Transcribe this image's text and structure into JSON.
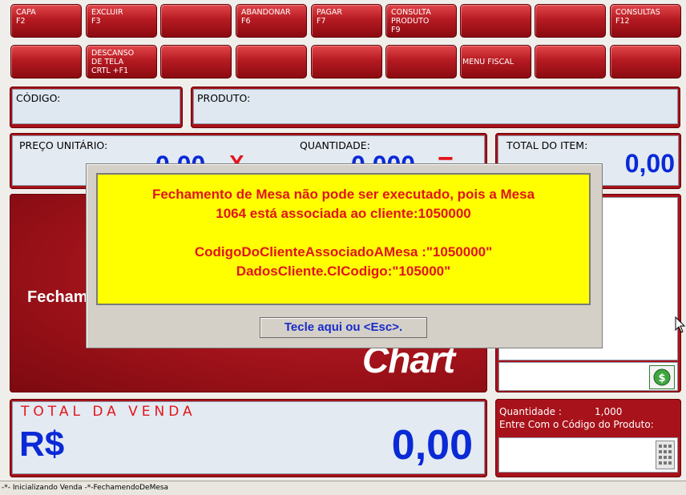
{
  "buttons_row1": [
    {
      "label": "CAPA\nF2"
    },
    {
      "label": "EXCLUIR\nF3"
    },
    {
      "label": ""
    },
    {
      "label": "ABANDONAR\nF6"
    },
    {
      "label": "PAGAR\nF7"
    },
    {
      "label": "CONSULTA\nPRODUTO\nF9"
    },
    {
      "label": ""
    },
    {
      "label": ""
    },
    {
      "label": "CONSULTAS\nF12"
    }
  ],
  "buttons_row2": [
    {
      "label": ""
    },
    {
      "label": "DESCANSO\nDE TELA\nCRTL +F1"
    },
    {
      "label": ""
    },
    {
      "label": ""
    },
    {
      "label": ""
    },
    {
      "label": ""
    },
    {
      "label": "MENU FISCAL"
    },
    {
      "label": ""
    },
    {
      "label": ""
    }
  ],
  "codigo": {
    "label": "CÓDIGO:",
    "value": ""
  },
  "produto": {
    "label": "PRODUTO:",
    "value": ""
  },
  "preco": {
    "label": "PREÇO UNITÁRIO:",
    "value": "0,00"
  },
  "multiply_sign": "X",
  "quantidade": {
    "label": "QUANTIDADE:",
    "value": "0,000"
  },
  "equals_sign": "=",
  "total_item": {
    "label": "TOTAL DO ITEM:",
    "value": "0,00"
  },
  "main_panel": {
    "text": "Fecham",
    "brand": "Chart"
  },
  "total_venda": {
    "label": "TOTAL DA VENDA",
    "currency": "R$",
    "value": "0,00"
  },
  "right_info": {
    "quantidade_label": "Quantidade :",
    "quantidade_value": "1,000",
    "prompt": "Entre Com o Código do Produto:"
  },
  "dialog": {
    "line1": "Fechamento de Mesa não pode ser executado, pois a Mesa",
    "line2": "1064 está associada ao cliente:1050000",
    "line3": "CodigoDoClienteAssociadoAMesa :\"1050000\"",
    "line4": "DadosCliente.ClCodigo:\"105000\"",
    "button": "Tecle aqui ou <Esc>."
  },
  "status_bar": "-*- Inicializando Venda -*-FechamendoDeMesa",
  "colors": {
    "primary_red": "#a8121a",
    "value_blue": "#0a2ad6",
    "dialog_yellow": "#ffff00",
    "dialog_text_red": "#e0151a"
  }
}
